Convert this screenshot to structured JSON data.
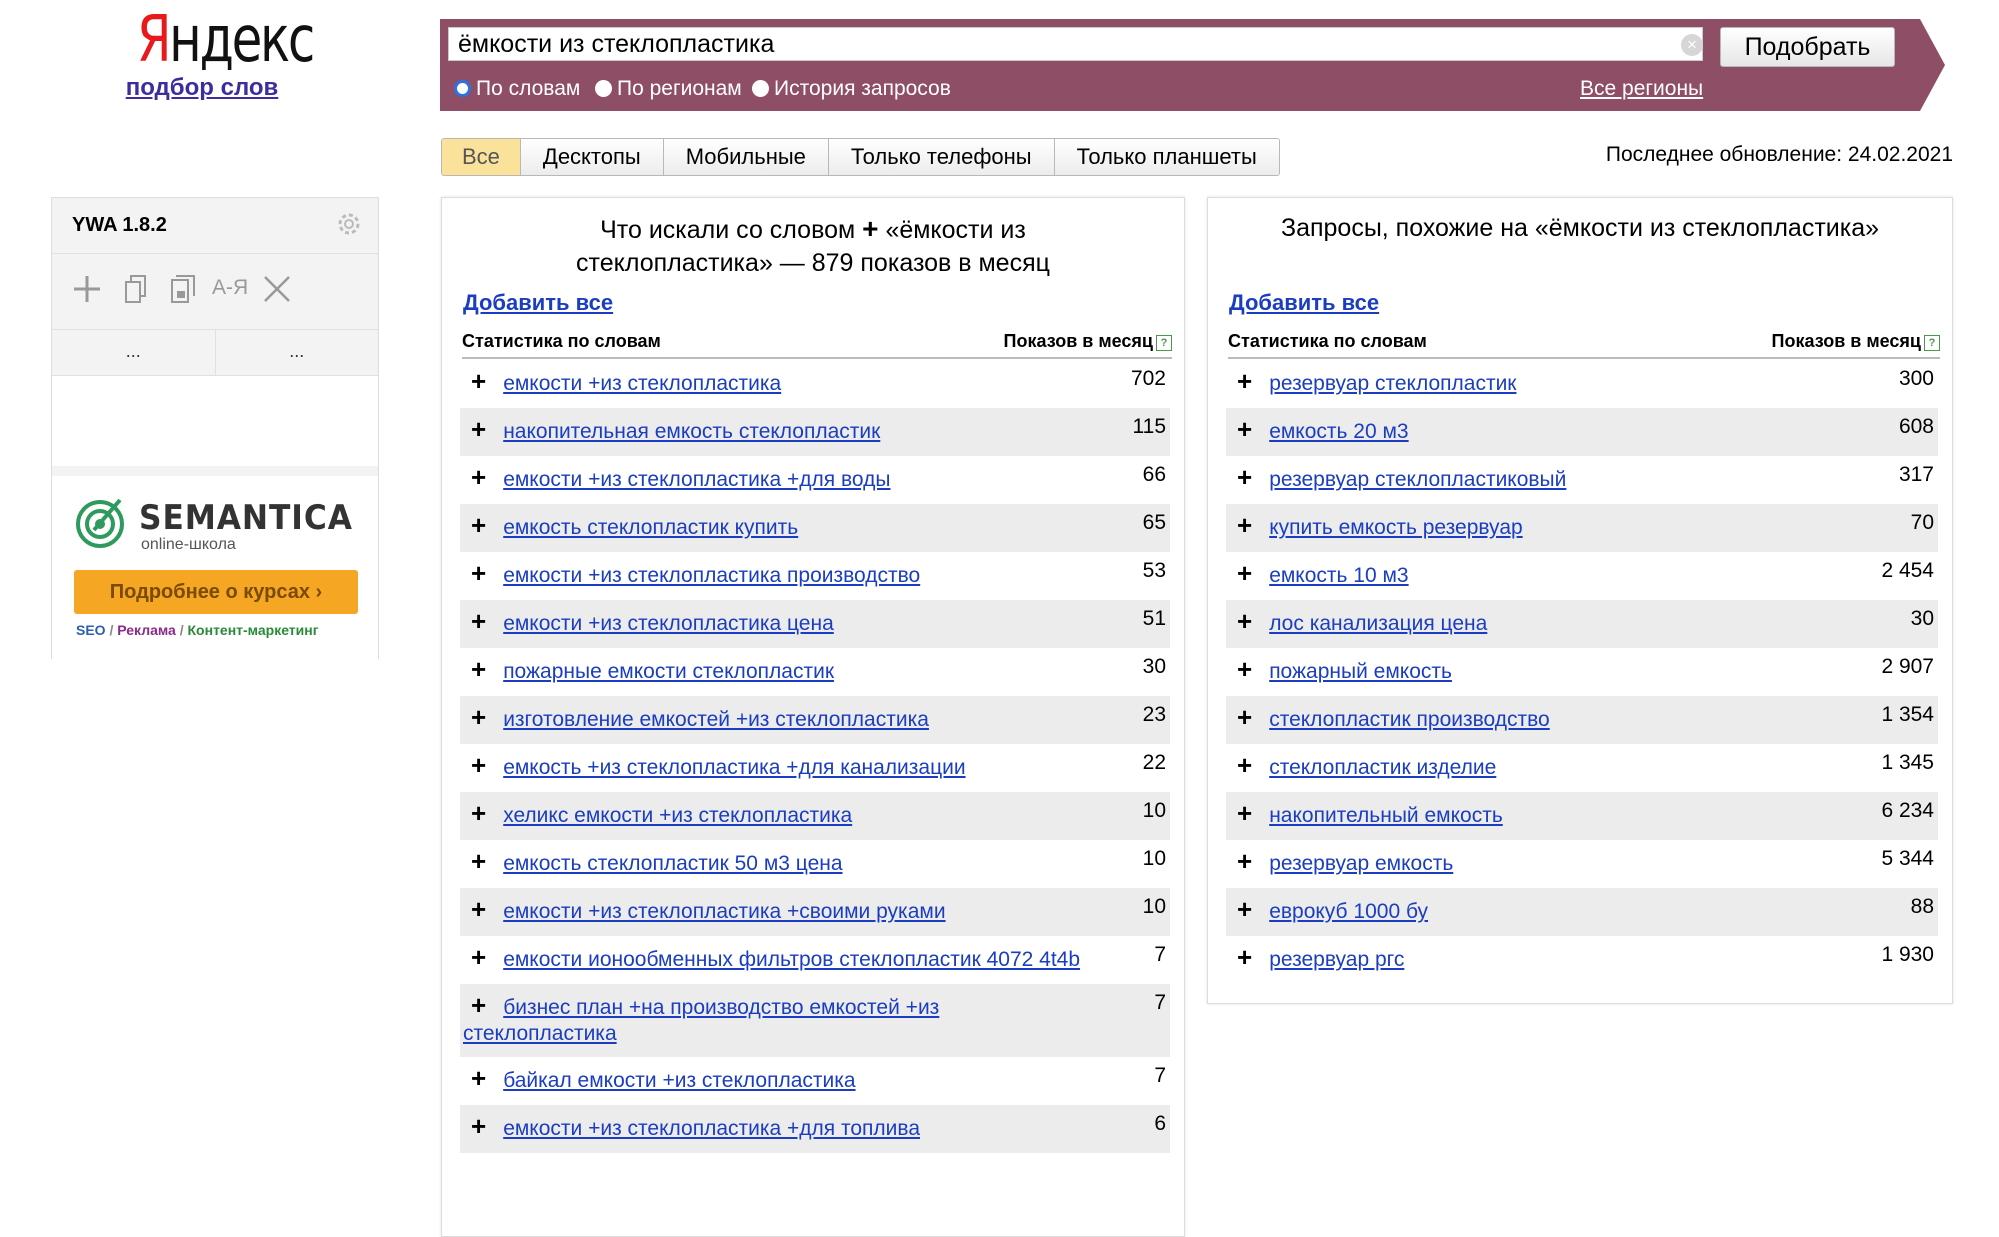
{
  "logo": {
    "brand_first": "Я",
    "brand_rest": "ндекс",
    "subtitle": "подбор слов"
  },
  "search": {
    "query": "ёмкости из стеклопластика",
    "submit_label": "Подобрать",
    "modes": [
      "По словам",
      "По регионам",
      "История запросов"
    ],
    "selected_mode": "По словам",
    "regions_link": "Все регионы"
  },
  "tabs": [
    "Все",
    "Десктопы",
    "Мобильные",
    "Только телефоны",
    "Только планшеты"
  ],
  "active_tab": "Все",
  "last_update": "Последнее обновление: 24.02.2021",
  "ywa": {
    "title": "YWA 1.8.2",
    "tool_icons": [
      "plus-icon",
      "copy-icon",
      "export-icon",
      "sort-az-icon",
      "clear-icon"
    ],
    "sort_label": "А-Я",
    "col1": "...",
    "col2": "...",
    "ad": {
      "name": "SEMANTICA",
      "sub": "online-школа",
      "button": "Подробнее о курсах ›",
      "tag1": "SEO",
      "sep1": " / ",
      "tag2": "Реклама",
      "sep2": " / ",
      "tag3": "Контент-маркетинг",
      "tag_colors": [
        "#2b5fb0",
        "#8a2a8a",
        "#2a8a3a"
      ]
    }
  },
  "left_panel": {
    "title_prefix": "Что искали со словом",
    "title_suffix": "«ёмкости из стеклопластика» — 879 показов в месяц",
    "add_all": "Добавить все",
    "col_keyword": "Статистика по словам",
    "col_count": "Показов в месяц",
    "rows": [
      {
        "kw": "емкости +из стеклопластика",
        "count": "702"
      },
      {
        "kw": "накопительная емкость стеклопластик",
        "count": "115"
      },
      {
        "kw": "емкости +из стеклопластика +для воды",
        "count": "66"
      },
      {
        "kw": "емкость стеклопластик купить",
        "count": "65"
      },
      {
        "kw": "емкости +из стеклопластика производство",
        "count": "53"
      },
      {
        "kw": "емкости +из стеклопластика цена",
        "count": "51"
      },
      {
        "kw": "пожарные емкости стеклопластик",
        "count": "30"
      },
      {
        "kw": "изготовление емкостей +из стеклопластика",
        "count": "23"
      },
      {
        "kw": "емкость +из стеклопластика +для канализации",
        "count": "22"
      },
      {
        "kw": "хеликс емкости +из стеклопластика",
        "count": "10"
      },
      {
        "kw": "емкость стеклопластик 50 м3 цена",
        "count": "10"
      },
      {
        "kw": "емкости +из стеклопластика +своими руками",
        "count": "10"
      },
      {
        "kw": "емкости ионообменных фильтров стеклопластик 4072 4t4b",
        "count": "7"
      },
      {
        "kw": "бизнес план +на производство емкостей +из стеклопластика",
        "count": "7"
      },
      {
        "kw": "байкал емкости +из стеклопластика",
        "count": "7"
      },
      {
        "kw": "емкости +из стеклопластика +для топлива",
        "count": "6"
      }
    ]
  },
  "right_panel": {
    "title": "Запросы, похожие на «ёмкости из стеклопластика»",
    "add_all": "Добавить все",
    "col_keyword": "Статистика по словам",
    "col_count": "Показов в месяц",
    "rows": [
      {
        "kw": "резервуар стеклопластик",
        "count": "300"
      },
      {
        "kw": "емкость 20 м3",
        "count": "608"
      },
      {
        "kw": "резервуар стеклопластиковый",
        "count": "317"
      },
      {
        "kw": "купить емкость резервуар",
        "count": "70"
      },
      {
        "kw": "емкость 10 м3",
        "count": "2 454"
      },
      {
        "kw": "лос канализация цена",
        "count": "30"
      },
      {
        "kw": "пожарный емкость",
        "count": "2 907"
      },
      {
        "kw": "стеклопластик производство",
        "count": "1 354"
      },
      {
        "kw": "стеклопластик изделие",
        "count": "1 345"
      },
      {
        "kw": "накопительный емкость",
        "count": "6 234"
      },
      {
        "kw": "резервуар емкость",
        "count": "5 344"
      },
      {
        "kw": "еврокуб 1000 бу",
        "count": "88"
      },
      {
        "kw": "резервуар ргс",
        "count": "1 930"
      }
    ]
  },
  "colors": {
    "search_bar": "#8e4e65",
    "link": "#1a3dc1",
    "active_tab": "#fbe29b",
    "ad_button": "#f5a623"
  }
}
